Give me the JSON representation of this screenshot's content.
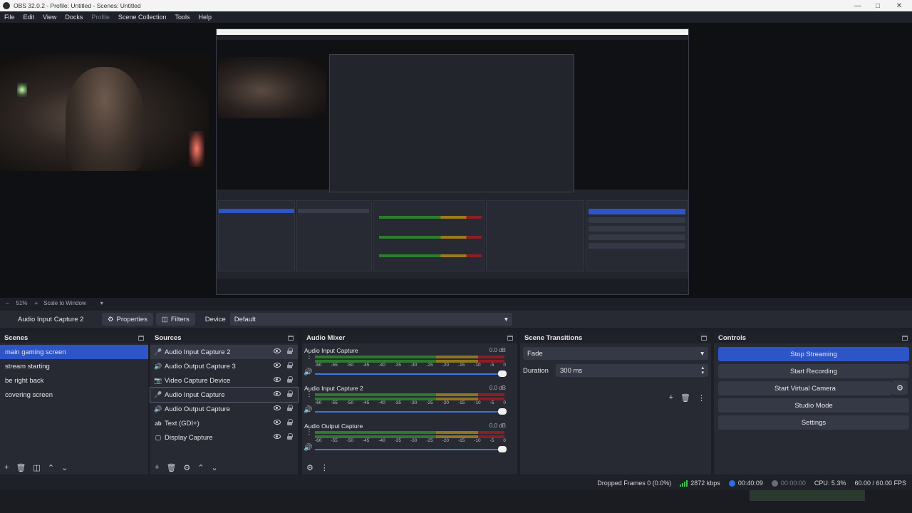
{
  "window": {
    "title": "OBS 32.0.2 - Profile: Untitled - Scenes: Untitled"
  },
  "menu": [
    "File",
    "Edit",
    "View",
    "Docks",
    "Profile",
    "Scene Collection",
    "Tools",
    "Help"
  ],
  "menu_disabled": [
    "Profile"
  ],
  "zoom": {
    "percent": "51%",
    "mode": "Scale to Window"
  },
  "context": {
    "source": "Audio Input Capture 2",
    "properties": "Properties",
    "filters": "Filters",
    "device_label": "Device",
    "device_value": "Default"
  },
  "scenes": {
    "title": "Scenes",
    "items": [
      "main gaming screen",
      "stream starting",
      "be right back",
      "covering screen"
    ],
    "selected_index": 0
  },
  "sources": {
    "title": "Sources",
    "items": [
      {
        "name": "Audio Input Capture 2",
        "icon": "microphone-icon"
      },
      {
        "name": "Audio Output Capture 3",
        "icon": "speaker-icon"
      },
      {
        "name": "Video Capture Device",
        "icon": "camera-icon"
      },
      {
        "name": "Audio Input Capture",
        "icon": "microphone-icon"
      },
      {
        "name": "Audio Output Capture",
        "icon": "speaker-icon"
      },
      {
        "name": "Text (GDI+)",
        "icon": "text-icon"
      },
      {
        "name": "Display Capture",
        "icon": "monitor-icon"
      }
    ]
  },
  "mixer": {
    "title": "Audio Mixer",
    "scale": [
      "-60",
      "-55",
      "-50",
      "-45",
      "-40",
      "-35",
      "-30",
      "-25",
      "-20",
      "-15",
      "-10",
      "-5",
      "0"
    ],
    "channels": [
      {
        "name": "Audio Input Capture",
        "db": "0.0 dB"
      },
      {
        "name": "Audio Input Capture 2",
        "db": "0.0 dB"
      },
      {
        "name": "Audio Output Capture",
        "db": "0.0 dB"
      }
    ]
  },
  "transitions": {
    "title": "Scene Transitions",
    "type": "Fade",
    "duration_label": "Duration",
    "duration_value": "300 ms"
  },
  "controls": {
    "title": "Controls",
    "stop_streaming": "Stop Streaming",
    "start_recording": "Start Recording",
    "start_virtual_camera": "Start Virtual Camera",
    "studio_mode": "Studio Mode",
    "settings": "Settings"
  },
  "status": {
    "dropped_frames": "Dropped Frames 0 (0.0%)",
    "bitrate": "2872 kbps",
    "stream_time": "00:40:09",
    "record_time": "00:00:00",
    "cpu": "CPU: 5.3%",
    "fps": "60.00 / 60.00 FPS"
  },
  "colors": {
    "accent": "#2d55c8",
    "panel": "#272a33",
    "background": "#1d1f26"
  }
}
